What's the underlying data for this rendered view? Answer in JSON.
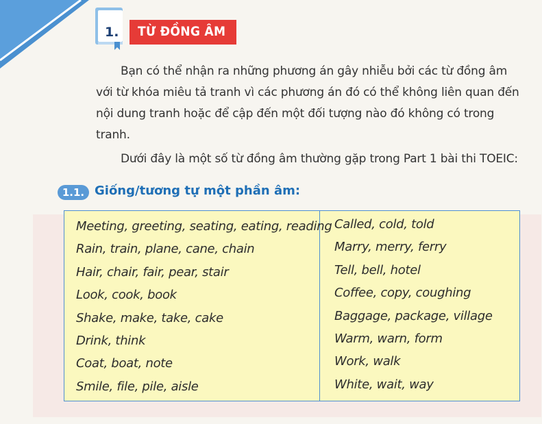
{
  "section": {
    "number": "1.",
    "title": "TỪ ĐỒNG ÂM"
  },
  "paragraphs": {
    "intro": "Bạn có thể nhận ra những phương án gây nhiễu bởi các từ đồng âm với từ khóa miêu tả tranh vì các phương án đó có thể không liên quan đến nội dung tranh hoặc để cập đến một đối tượng nào đó không có trong tranh.",
    "list_intro": "Dưới đây là một số từ đồng âm thường gặp trong Part 1 bài thi TOEIC:"
  },
  "subsection": {
    "number": "1.1.",
    "title": "Giống/tương tự một phần âm:"
  },
  "word_table": {
    "left": [
      "Meeting, greeting, seating, eating, reading",
      "Rain, train, plane, cane, chain",
      "Hair, chair, fair, pear, stair",
      "Look, cook, book",
      "Shake, make, take, cake",
      "Drink, think",
      "Coat, boat, note",
      "Smile, file, pile, aisle"
    ],
    "right": [
      "Called, cold, told",
      "Marry, merry, ferry",
      "Tell, bell, hotel",
      "Coffee, copy, coughing",
      "Baggage, package, village",
      "Warm, warn, form",
      "Work, walk",
      "White, wait, way"
    ]
  },
  "colors": {
    "corner": "#4a90d0",
    "title_bar": "#e63b37",
    "section_number": "#1c3f73",
    "subtitle": "#1f6fb6",
    "table_bg": "#fbf8bf",
    "table_border": "#4e8fd0"
  }
}
